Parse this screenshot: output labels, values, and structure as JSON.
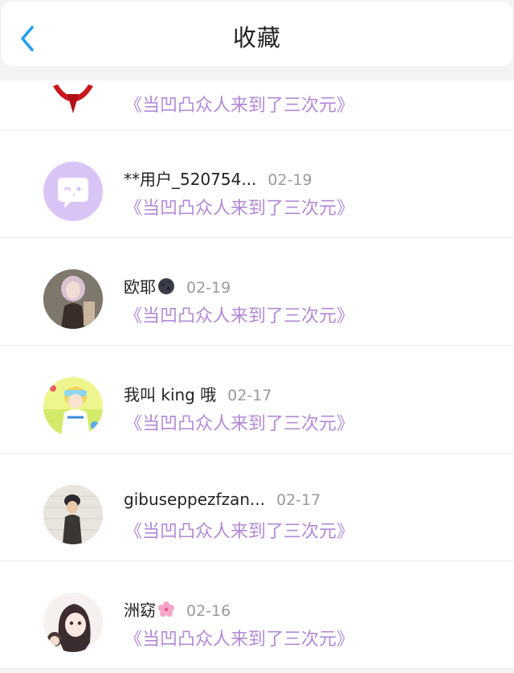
{
  "header": {
    "title": "收藏",
    "back_icon": "chevron-left-icon"
  },
  "colors": {
    "accent": "#1e9ef0",
    "album_text": "#b289d6",
    "date_text": "#9a9a9a"
  },
  "items": [
    {
      "name": "",
      "date": "",
      "album": "《当凹凸众人来到了三次元》",
      "avatar": "red-character-avatar"
    },
    {
      "name": "**用户_520754...",
      "date": "02-19",
      "album": "《当凹凸众人来到了三次元》",
      "avatar": "default-purple-chat-avatar"
    },
    {
      "name": "欧耶",
      "date": "02-19",
      "album": "《当凹凸众人来到了三次元》",
      "avatar": "girl-photo-avatar",
      "emoji": "dark-moon-emoji"
    },
    {
      "name": "我叫 king 哦",
      "date": "02-17",
      "album": "《当凹凸众人来到了三次元》",
      "avatar": "anime-boy-avatar"
    },
    {
      "name": "gibuseppezfzan...",
      "date": "02-17",
      "album": "《当凹凸众人来到了三次元》",
      "avatar": "girl-beanie-photo-avatar"
    },
    {
      "name": "洲窈",
      "date": "02-16",
      "album": "《当凹凸众人来到了三次元》",
      "avatar": "anime-girl-avatar",
      "emoji": "cherry-blossom-emoji"
    }
  ]
}
